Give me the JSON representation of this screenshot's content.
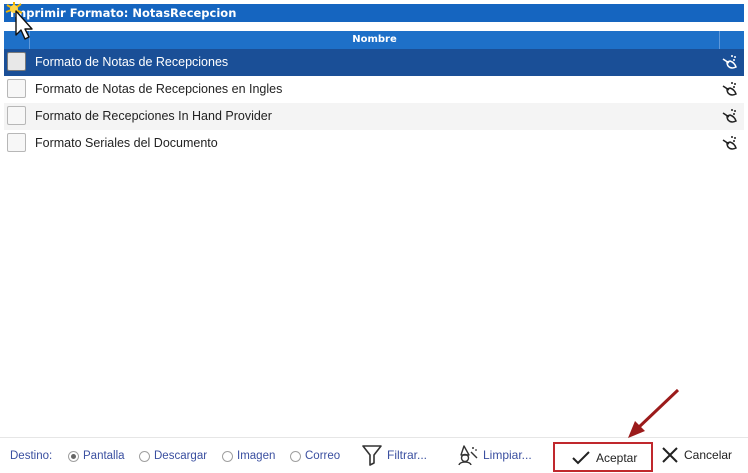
{
  "window": {
    "title": "Imprimir Formato: NotasRecepcion"
  },
  "grid": {
    "column_name": "Nombre",
    "rows": [
      {
        "label": "Formato de Notas de Recepciones",
        "selected": true
      },
      {
        "label": "Formato de Notas de Recepciones en Ingles",
        "selected": false
      },
      {
        "label": "Formato de Recepciones In Hand Provider",
        "selected": false
      },
      {
        "label": "Formato Seriales del Documento",
        "selected": false
      }
    ],
    "row_action_icon": "broom-clean-icon"
  },
  "footer": {
    "destino_label": "Destino:",
    "options": [
      {
        "label": "Pantalla",
        "selected": true
      },
      {
        "label": "Descargar",
        "selected": false
      },
      {
        "label": "Imagen",
        "selected": false
      },
      {
        "label": "Correo",
        "selected": false
      }
    ],
    "filter_label": "Filtrar...",
    "clear_label": "Limpiar...",
    "accept_label": "Aceptar",
    "cancel_label": "Cancelar"
  },
  "colors": {
    "title_bar": "#1565c0",
    "header": "#1e70c8",
    "selected_row": "#1a4f97",
    "highlight_border": "#c0282d",
    "arrow": "#9b1b1b"
  }
}
